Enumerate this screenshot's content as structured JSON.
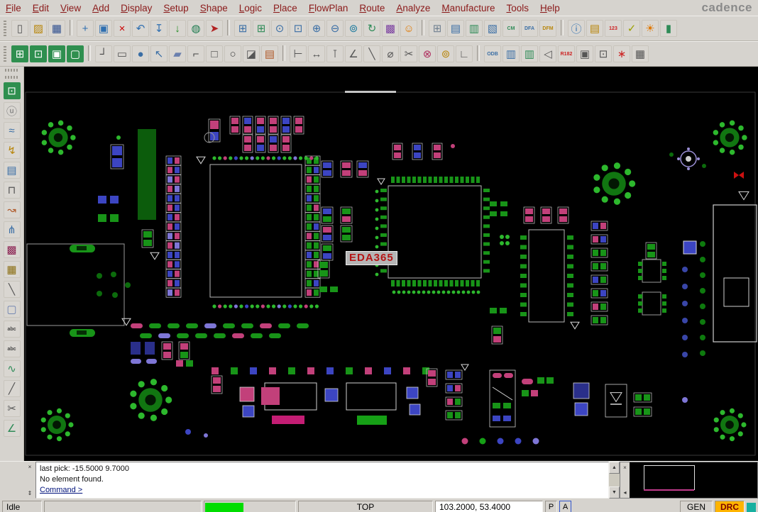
{
  "menu": {
    "items": [
      "File",
      "Edit",
      "View",
      "Add",
      "Display",
      "Setup",
      "Shape",
      "Logic",
      "Place",
      "FlowPlan",
      "Route",
      "Analyze",
      "Manufacture",
      "Tools",
      "Help"
    ],
    "brand": "cadence"
  },
  "toolbar_row1": [
    {
      "name": "new-design",
      "glyph": "▯",
      "color": "#555555"
    },
    {
      "name": "open-design",
      "glyph": "▨",
      "color": "#b8860b"
    },
    {
      "name": "save-design",
      "glyph": "▦",
      "color": "#2f4f8f"
    },
    {
      "sep": true
    },
    {
      "name": "move",
      "glyph": "+",
      "color": "#2f6fb0"
    },
    {
      "name": "copy",
      "glyph": "▣",
      "color": "#2f6fb0"
    },
    {
      "name": "delete",
      "glyph": "×",
      "color": "#cc0000"
    },
    {
      "name": "undo",
      "glyph": "↶",
      "color": "#2f6fb0"
    },
    {
      "name": "fix",
      "glyph": "↧",
      "color": "#2f6fb0"
    },
    {
      "name": "unfix",
      "glyph": "↓",
      "color": "#228b22"
    },
    {
      "name": "freeze-net",
      "glyph": "◍",
      "color": "#1e7b4f"
    },
    {
      "name": "pin-mark",
      "glyph": "➤",
      "color": "#b22222"
    },
    {
      "sep": true
    },
    {
      "name": "grid-snap",
      "glyph": "⊞",
      "color": "#3a6ea5"
    },
    {
      "name": "grid-display",
      "glyph": "⊞",
      "color": "#2e8b57"
    },
    {
      "name": "zoom-points",
      "glyph": "⊙",
      "color": "#3a6ea5"
    },
    {
      "name": "zoom-fit",
      "glyph": "⊡",
      "color": "#3a6ea5"
    },
    {
      "name": "zoom-in",
      "glyph": "⊕",
      "color": "#3a6ea5"
    },
    {
      "name": "zoom-out",
      "glyph": "⊖",
      "color": "#3a6ea5"
    },
    {
      "name": "zoom-world",
      "glyph": "⊚",
      "color": "#1e7b9e"
    },
    {
      "name": "redraw",
      "glyph": "↻",
      "color": "#2e8b57"
    },
    {
      "name": "color192",
      "glyph": "▩",
      "color": "#7b3fa0"
    },
    {
      "name": "shell",
      "glyph": "☺",
      "color": "#e07800"
    },
    {
      "sep": true
    },
    {
      "name": "design-grid",
      "glyph": "⊞",
      "color": "#708090"
    },
    {
      "name": "layers",
      "glyph": "▤",
      "color": "#3a6ea5"
    },
    {
      "name": "cross-section",
      "glyph": "▥",
      "color": "#2e8b57"
    },
    {
      "name": "shadow-mode",
      "glyph": "▧",
      "color": "#3a6ea5"
    },
    {
      "name": "cm-check",
      "glyph": "CM",
      "color": "#2e8b57"
    },
    {
      "name": "dfa-check",
      "glyph": "DFA",
      "color": "#3a6ea5"
    },
    {
      "name": "dfm-check",
      "glyph": "DFM",
      "color": "#b8860b"
    },
    {
      "sep": true
    },
    {
      "name": "info",
      "glyph": "ⓘ",
      "color": "#2f6fb0"
    },
    {
      "name": "properties",
      "glyph": "▤",
      "color": "#b8860b"
    },
    {
      "name": "numbers",
      "glyph": "123",
      "color": "#cc2222"
    },
    {
      "name": "verify",
      "glyph": "✓",
      "color": "#9aa000"
    },
    {
      "name": "highlight-sun",
      "glyph": "☀",
      "color": "#e07800"
    },
    {
      "name": "bars",
      "glyph": "▮",
      "color": "#2e8b57"
    }
  ],
  "toolbar_row2": [
    {
      "name": "visibility-green",
      "glyph": "⊞",
      "color": "#ffffff",
      "bg": "#2f8f4f"
    },
    {
      "name": "origin-green",
      "glyph": "⊡",
      "color": "#ffffff",
      "bg": "#2f8f4f"
    },
    {
      "name": "window-green",
      "glyph": "▣",
      "color": "#ffffff",
      "bg": "#2f8f4f"
    },
    {
      "name": "expand-green",
      "glyph": "▢",
      "color": "#ffffff",
      "bg": "#2f8f4f"
    },
    {
      "sep": true
    },
    {
      "name": "add-connect",
      "glyph": "┘",
      "color": "#444444"
    },
    {
      "name": "add-rect",
      "glyph": "▭",
      "color": "#555555"
    },
    {
      "name": "add-circle",
      "glyph": "●",
      "color": "#3a6ea5"
    },
    {
      "name": "select-cursor",
      "glyph": "↖",
      "color": "#3a6ea5"
    },
    {
      "name": "add-frect",
      "glyph": "▰",
      "color": "#6a7fae"
    },
    {
      "name": "add-arc",
      "glyph": "⌐",
      "color": "#444444"
    },
    {
      "name": "add-square",
      "glyph": "□",
      "color": "#444444"
    },
    {
      "name": "add-ellipse",
      "glyph": "○",
      "color": "#444444"
    },
    {
      "name": "add-slot",
      "glyph": "◪",
      "color": "#555555"
    },
    {
      "name": "padstack",
      "glyph": "▤",
      "color": "#b05a2a"
    },
    {
      "sep": true
    },
    {
      "name": "pin-tool",
      "glyph": "⊢",
      "color": "#555555"
    },
    {
      "name": "dimension",
      "glyph": "↔",
      "color": "#555555"
    },
    {
      "name": "linear-dim",
      "glyph": "⊺",
      "color": "#555555"
    },
    {
      "name": "angle-dim",
      "glyph": "∠",
      "color": "#555555"
    },
    {
      "name": "diagonal-line",
      "glyph": "╲",
      "color": "#555555"
    },
    {
      "name": "diameter-dim",
      "glyph": "⌀",
      "color": "#555555"
    },
    {
      "name": "cut-tool",
      "glyph": "✂",
      "color": "#555555"
    },
    {
      "name": "highlight-tool",
      "glyph": "⊗",
      "color": "#b03060"
    },
    {
      "name": "circle-tap",
      "glyph": "⊚",
      "color": "#b8860b"
    },
    {
      "name": "corner-tool",
      "glyph": "∟",
      "color": "#555555"
    },
    {
      "sep": true
    },
    {
      "name": "odb-export",
      "glyph": "ODB",
      "color": "#3a6ea5"
    },
    {
      "name": "report-blue",
      "glyph": "▥",
      "color": "#3a6ea5"
    },
    {
      "name": "report-green",
      "glyph": "▥",
      "color": "#2e8b57"
    },
    {
      "name": "audit-left",
      "glyph": "◁",
      "color": "#555555"
    },
    {
      "name": "r182-label",
      "glyph": "R182",
      "color": "#cc2222"
    },
    {
      "name": "flag-tool",
      "glyph": "▣",
      "color": "#555555"
    },
    {
      "name": "window-select",
      "glyph": "⊡",
      "color": "#555555"
    },
    {
      "name": "attach-star",
      "glyph": "∗",
      "color": "#cc2222"
    },
    {
      "name": "matrix-tool",
      "glyph": "▦",
      "color": "#555555"
    }
  ],
  "sidebar_icons": [
    {
      "name": "zoom-area",
      "glyph": "⊡",
      "color": "#ffffff",
      "bg": "#2f8f4f"
    },
    {
      "name": "circled-u",
      "glyph": "ⓤ",
      "color": "#777777"
    },
    {
      "name": "waveform",
      "glyph": "≈",
      "color": "#3a6ea5"
    },
    {
      "name": "probe",
      "glyph": "↯",
      "color": "#b8860b"
    },
    {
      "name": "snapshot",
      "glyph": "▤",
      "color": "#3a6ea5"
    },
    {
      "name": "stub",
      "glyph": "⊓",
      "color": "#555555"
    },
    {
      "name": "route-path",
      "glyph": "↝",
      "color": "#b05a2a"
    },
    {
      "name": "spread",
      "glyph": "⋔",
      "color": "#3a6ea5"
    },
    {
      "name": "pattern",
      "glyph": "▩",
      "color": "#8b2252"
    },
    {
      "name": "grid-dots",
      "glyph": "▦",
      "color": "#8b6f14"
    },
    {
      "name": "add-line-side",
      "glyph": "╲",
      "color": "#555555"
    },
    {
      "name": "add-rect-side",
      "glyph": "▢",
      "color": "#6a7fae"
    },
    {
      "name": "text-abc",
      "glyph": "abc",
      "color": "#444444"
    },
    {
      "name": "text-abc-dot",
      "glyph": "abc",
      "color": "#444444"
    },
    {
      "name": "snake-route",
      "glyph": "∿",
      "color": "#2e8b57"
    },
    {
      "name": "cline",
      "glyph": "╱",
      "color": "#555555"
    },
    {
      "name": "trim",
      "glyph": "✂",
      "color": "#555555"
    },
    {
      "name": "measure-angle",
      "glyph": "∠",
      "color": "#2e8b57"
    }
  ],
  "canvas": {
    "watermark": "EDA365"
  },
  "console": {
    "lines": [
      "last pick:  -15.5000  9.7000",
      "No element found.",
      "Command >"
    ],
    "gutter_top_glyph": "×",
    "gutter_bottom_glyph": "⇕",
    "scroll_up_glyph": "▲",
    "scroll_down_glyph": "▼"
  },
  "minimap": {
    "gutter_top_glyph": "×",
    "gutter_bottom_glyph": "◂"
  },
  "statusbar": {
    "mode": "Idle",
    "layer": "TOP",
    "coords": "103.2000, 53.4000",
    "p_label": "P",
    "a_label": "A",
    "gen_label": "GEN",
    "drc_label": "DRC"
  },
  "colors": {
    "menu_text": "#8b1a1a",
    "progress_green": "#00dd00",
    "drc_bg": "#ffb400",
    "pad_green": "#189418",
    "pad_pink": "#c2407a",
    "pad_blue": "#3c45c2",
    "pad_purple": "#7e76d6"
  }
}
